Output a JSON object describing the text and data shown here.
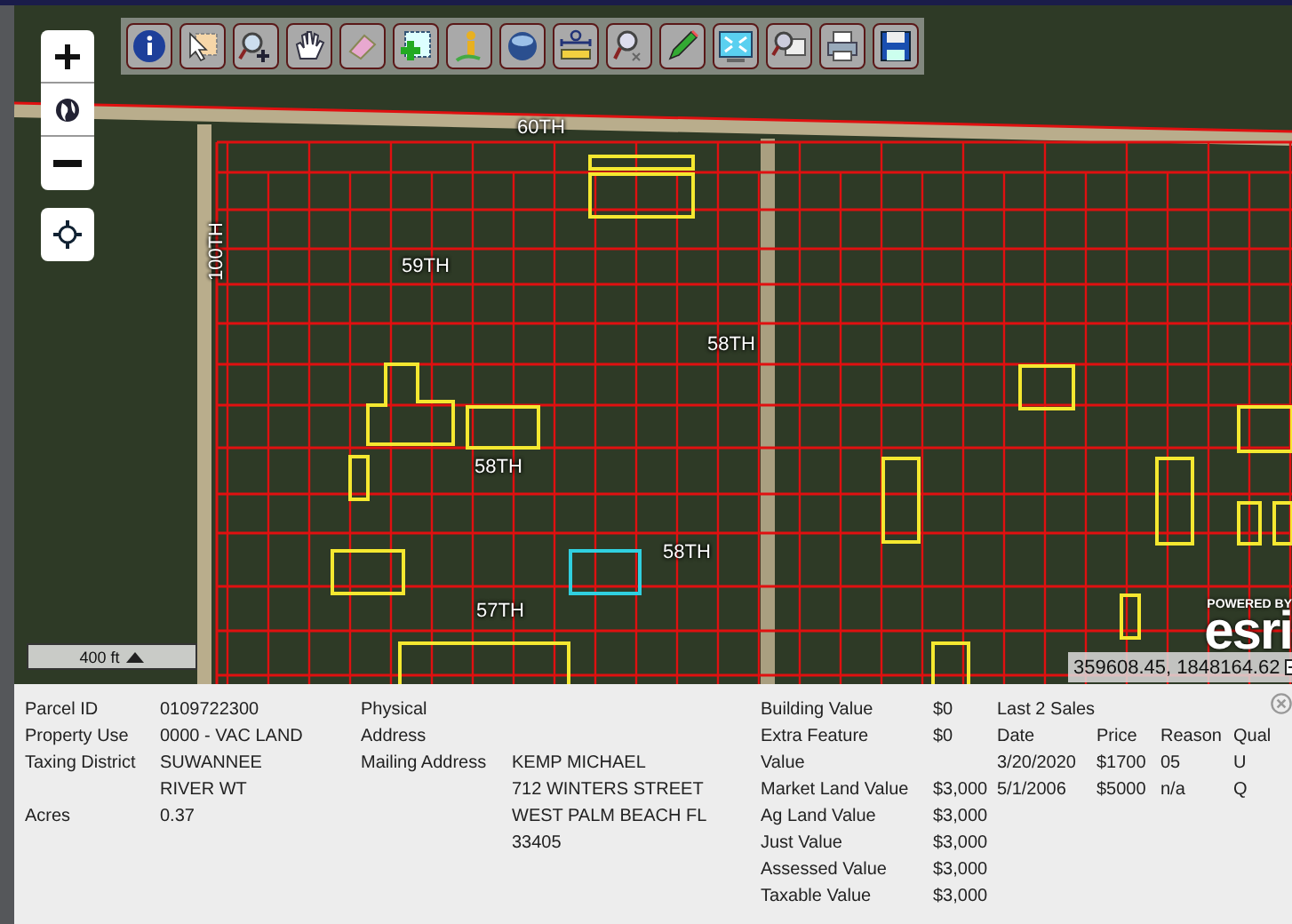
{
  "toolbar": {
    "tools": [
      {
        "kind": "info"
      },
      {
        "kind": "select"
      },
      {
        "kind": "zoom-in"
      },
      {
        "kind": "pan"
      },
      {
        "kind": "eraser"
      },
      {
        "kind": "add"
      },
      {
        "kind": "person"
      },
      {
        "kind": "globe"
      },
      {
        "kind": "measure"
      },
      {
        "kind": "zoom-xy"
      },
      {
        "kind": "pencil"
      },
      {
        "kind": "full-extent"
      },
      {
        "kind": "find"
      },
      {
        "kind": "print"
      },
      {
        "kind": "save"
      }
    ]
  },
  "map": {
    "street_labels": [
      {
        "text": "60TH",
        "kind": "horizontal"
      },
      {
        "text": "100TH",
        "kind": "vertical"
      },
      {
        "text": "59TH",
        "kind": "horizontal"
      },
      {
        "text": "58TH",
        "kind": "horizontal"
      },
      {
        "text": "58TH",
        "kind": "horizontal"
      },
      {
        "text": "58TH",
        "kind": "horizontal"
      },
      {
        "text": "57TH",
        "kind": "horizontal"
      }
    ],
    "scale_label": "400 ft",
    "coordinates": "359608.45, 1848164.62",
    "attribution": {
      "caption": "POWERED BY",
      "logo": "esri"
    }
  },
  "info_panel": {
    "parcel_fields": [
      {
        "label": "Parcel ID",
        "value": "0109722300"
      },
      {
        "label": "Property Use",
        "value": "0000 - VAC LAND"
      },
      {
        "label": "Taxing District",
        "value": "SUWANNEE RIVER WT"
      },
      {
        "label": "Acres",
        "value": "0.37"
      }
    ],
    "address_fields": [
      {
        "label": "Physical Address"
      },
      {
        "label": "Mailing Address",
        "lines": [
          "KEMP MICHAEL",
          "712 WINTERS STREET",
          "WEST PALM BEACH FL",
          "33405"
        ]
      }
    ],
    "value_fields": [
      {
        "label": "Building Value",
        "value": "$0"
      },
      {
        "label": "Extra Feature Value",
        "value": "$0"
      },
      {
        "label": "Market Land Value",
        "value": "$3,000"
      },
      {
        "label": "Ag Land Value",
        "value": "$3,000"
      },
      {
        "label": "Just Value",
        "value": "$3,000"
      },
      {
        "label": "Assessed Value",
        "value": "$3,000"
      },
      {
        "label": "Taxable Value",
        "value": "$3,000"
      }
    ],
    "sales": {
      "title": "Last 2 Sales",
      "columns": [
        "Date",
        "Price",
        "Reason",
        "Qual"
      ],
      "rows": [
        [
          "3/20/2020",
          "$1700",
          "05",
          "U"
        ],
        [
          "5/1/2006",
          "$5000",
          "n/a",
          "Q"
        ]
      ]
    }
  }
}
